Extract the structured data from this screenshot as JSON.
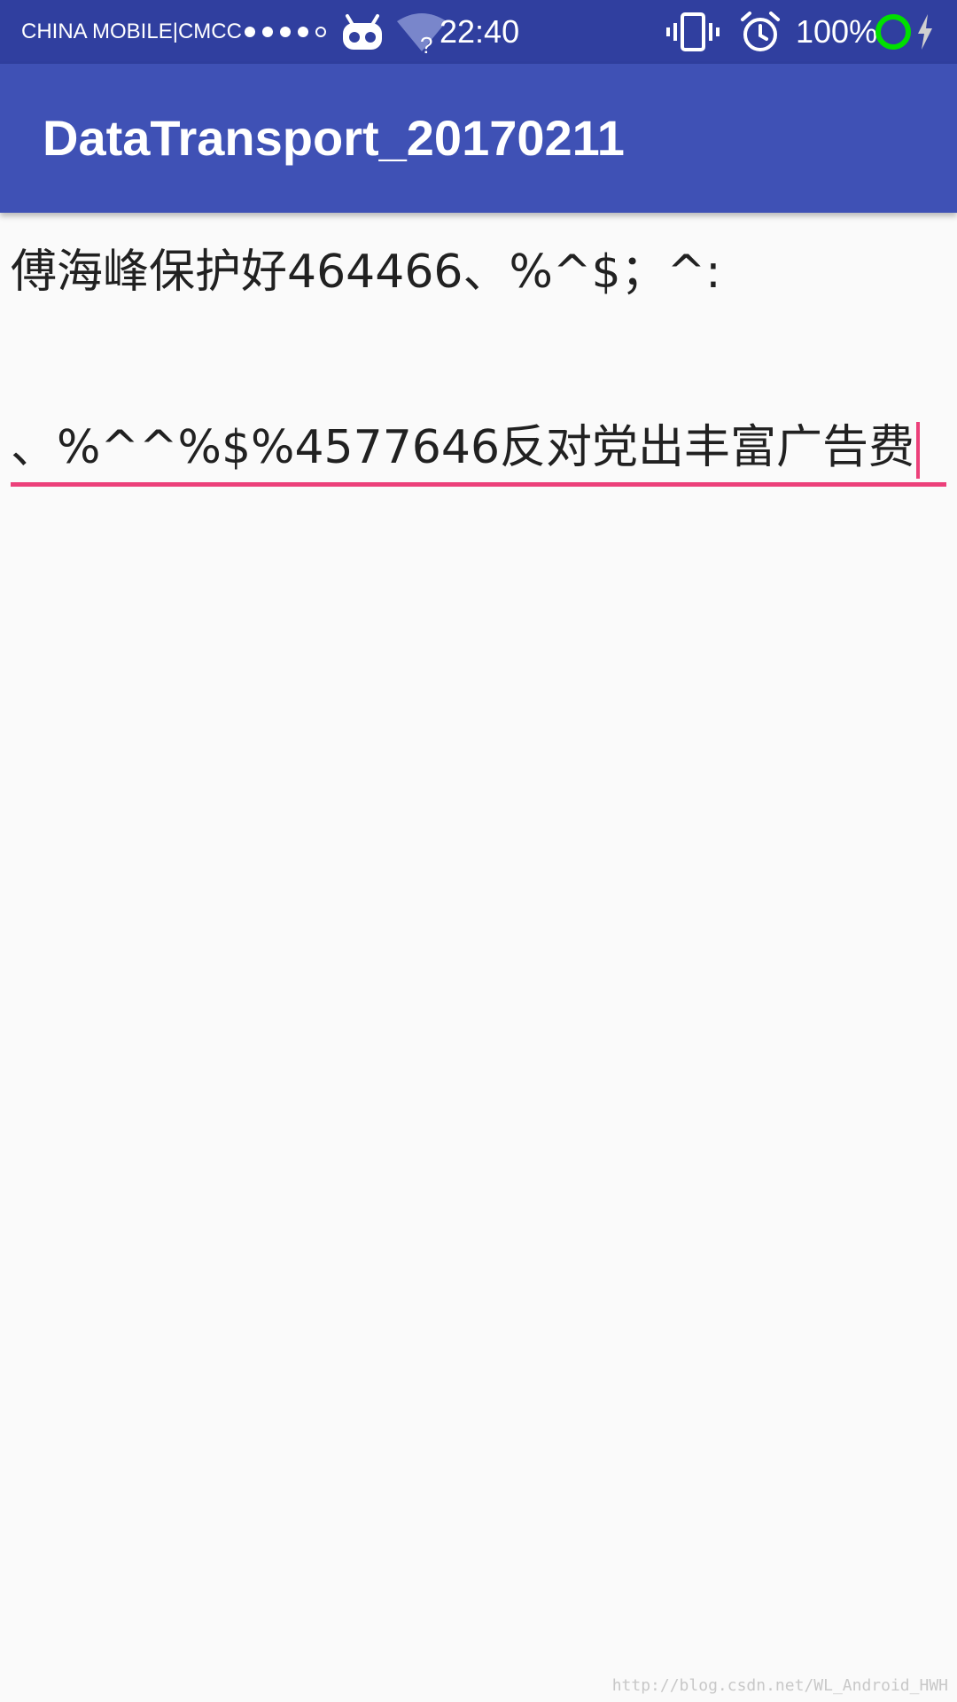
{
  "status_bar": {
    "carrier": "CHINA  MOBILE|CMCC",
    "time": "22:40",
    "battery_percent": "100%",
    "signal_strength": 4,
    "signal_max": 5,
    "icons": [
      "robot-icon",
      "wifi-icon",
      "vibrate-icon",
      "alarm-icon",
      "battery-ring-icon",
      "charging-bolt-icon"
    ],
    "colors": {
      "background": "#303f9f",
      "battery_ring": "#00e000"
    }
  },
  "app_bar": {
    "title": "DataTransport_20170211",
    "color": "#3f51b5"
  },
  "content": {
    "display_text": "傅海峰保护好464466、%^$；^:",
    "edit_text_value": "、%^^%$%4577646反对党出丰富广告费",
    "accent_color": "#ec407a"
  },
  "watermark": "http://blog.csdn.net/WL_Android_HWH"
}
